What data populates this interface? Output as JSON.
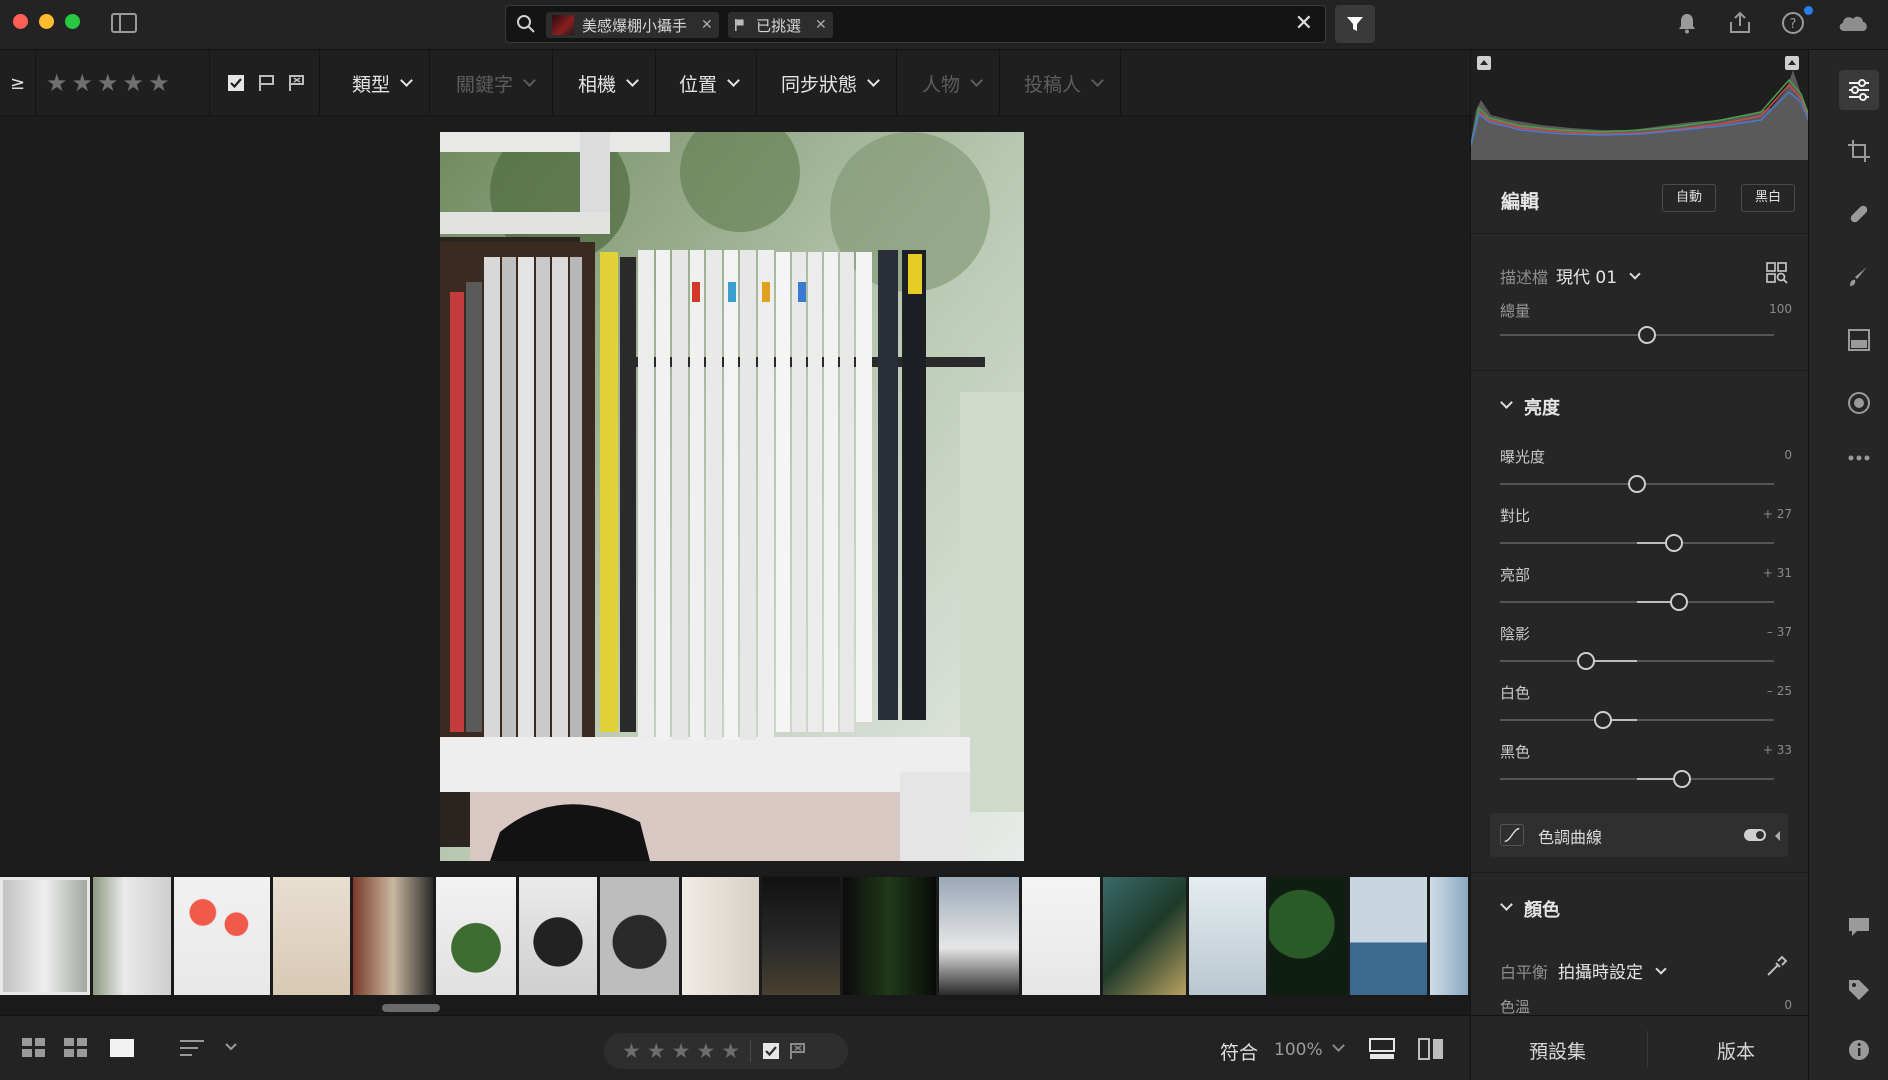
{
  "search": {
    "chips": [
      {
        "label": "美感爆棚小攝手"
      },
      {
        "label": "已挑選"
      }
    ]
  },
  "filterbar": {
    "gte": "≥",
    "stars": "★★★★★",
    "dropdowns": [
      {
        "label": "類型",
        "state": "on"
      },
      {
        "label": "關鍵字",
        "state": "off"
      },
      {
        "label": "相機",
        "state": "on"
      },
      {
        "label": "位置",
        "state": "on"
      },
      {
        "label": "同步狀態",
        "state": "on"
      },
      {
        "label": "人物",
        "state": "off"
      },
      {
        "label": "投稿人",
        "state": "off"
      }
    ]
  },
  "bottombar": {
    "stars": "★★★★★",
    "fit_label": "符合",
    "zoom_label": "100%"
  },
  "edit": {
    "title": "編輯",
    "auto_label": "自動",
    "bw_label": "黑白",
    "profile_label": "描述檔",
    "profile_value": "現代 01",
    "amount_label": "總量",
    "amount_value": "100",
    "light_title": "亮度",
    "sliders": [
      {
        "label": "曝光度",
        "value": "0",
        "pos": 0.5
      },
      {
        "label": "對比",
        "value": "+ 27",
        "pos": 0.635
      },
      {
        "label": "亮部",
        "value": "+ 31",
        "pos": 0.655
      },
      {
        "label": "陰影",
        "value": "– 37",
        "pos": 0.315
      },
      {
        "label": "白色",
        "value": "– 25",
        "pos": 0.375
      },
      {
        "label": "黑色",
        "value": "+ 33",
        "pos": 0.665
      }
    ],
    "curve_label": "色調曲線",
    "color_title": "顏色",
    "wb_label": "白平衡",
    "wb_value": "拍攝時設定",
    "temp_label": "色溫",
    "temp_value": "0"
  },
  "rtabs": {
    "presets_label": "預設集",
    "versions_label": "版本"
  },
  "colors": {
    "accent": "#2680eb",
    "panel": "#262626",
    "background": "#1c1c1c"
  }
}
